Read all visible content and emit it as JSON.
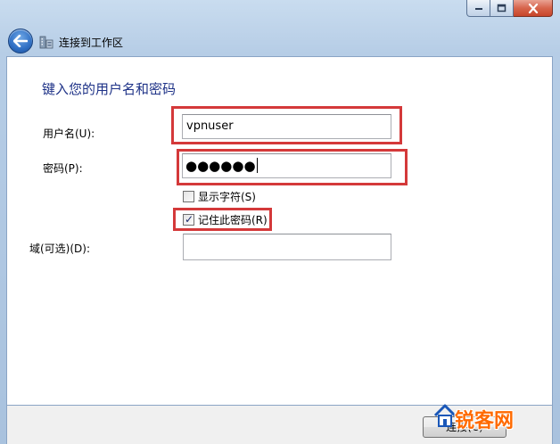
{
  "window": {
    "title": "连接到工作区"
  },
  "form": {
    "heading": "键入您的用户名和密码",
    "username_label": "用户名(U):",
    "username_value": "vpnuser",
    "password_label": "密码(P):",
    "password_value": "●●●●●●",
    "show_chars_label": "显示字符(S)",
    "show_chars_checked": false,
    "remember_label": "记住此密码(R)",
    "remember_checked": true,
    "domain_label": "域(可选)(D):",
    "domain_value": ""
  },
  "footer": {
    "connect_label": "连接(C)"
  },
  "watermark": {
    "text": "锐客网"
  },
  "colors": {
    "highlight": "#d4393a",
    "heading": "#1e3287",
    "frame": "#b6cde6"
  },
  "icons": {
    "back": "back-arrow-icon",
    "workplace": "network-workplace-icon",
    "minimize": "minimize-icon",
    "maximize": "maximize-icon",
    "close": "close-icon"
  }
}
